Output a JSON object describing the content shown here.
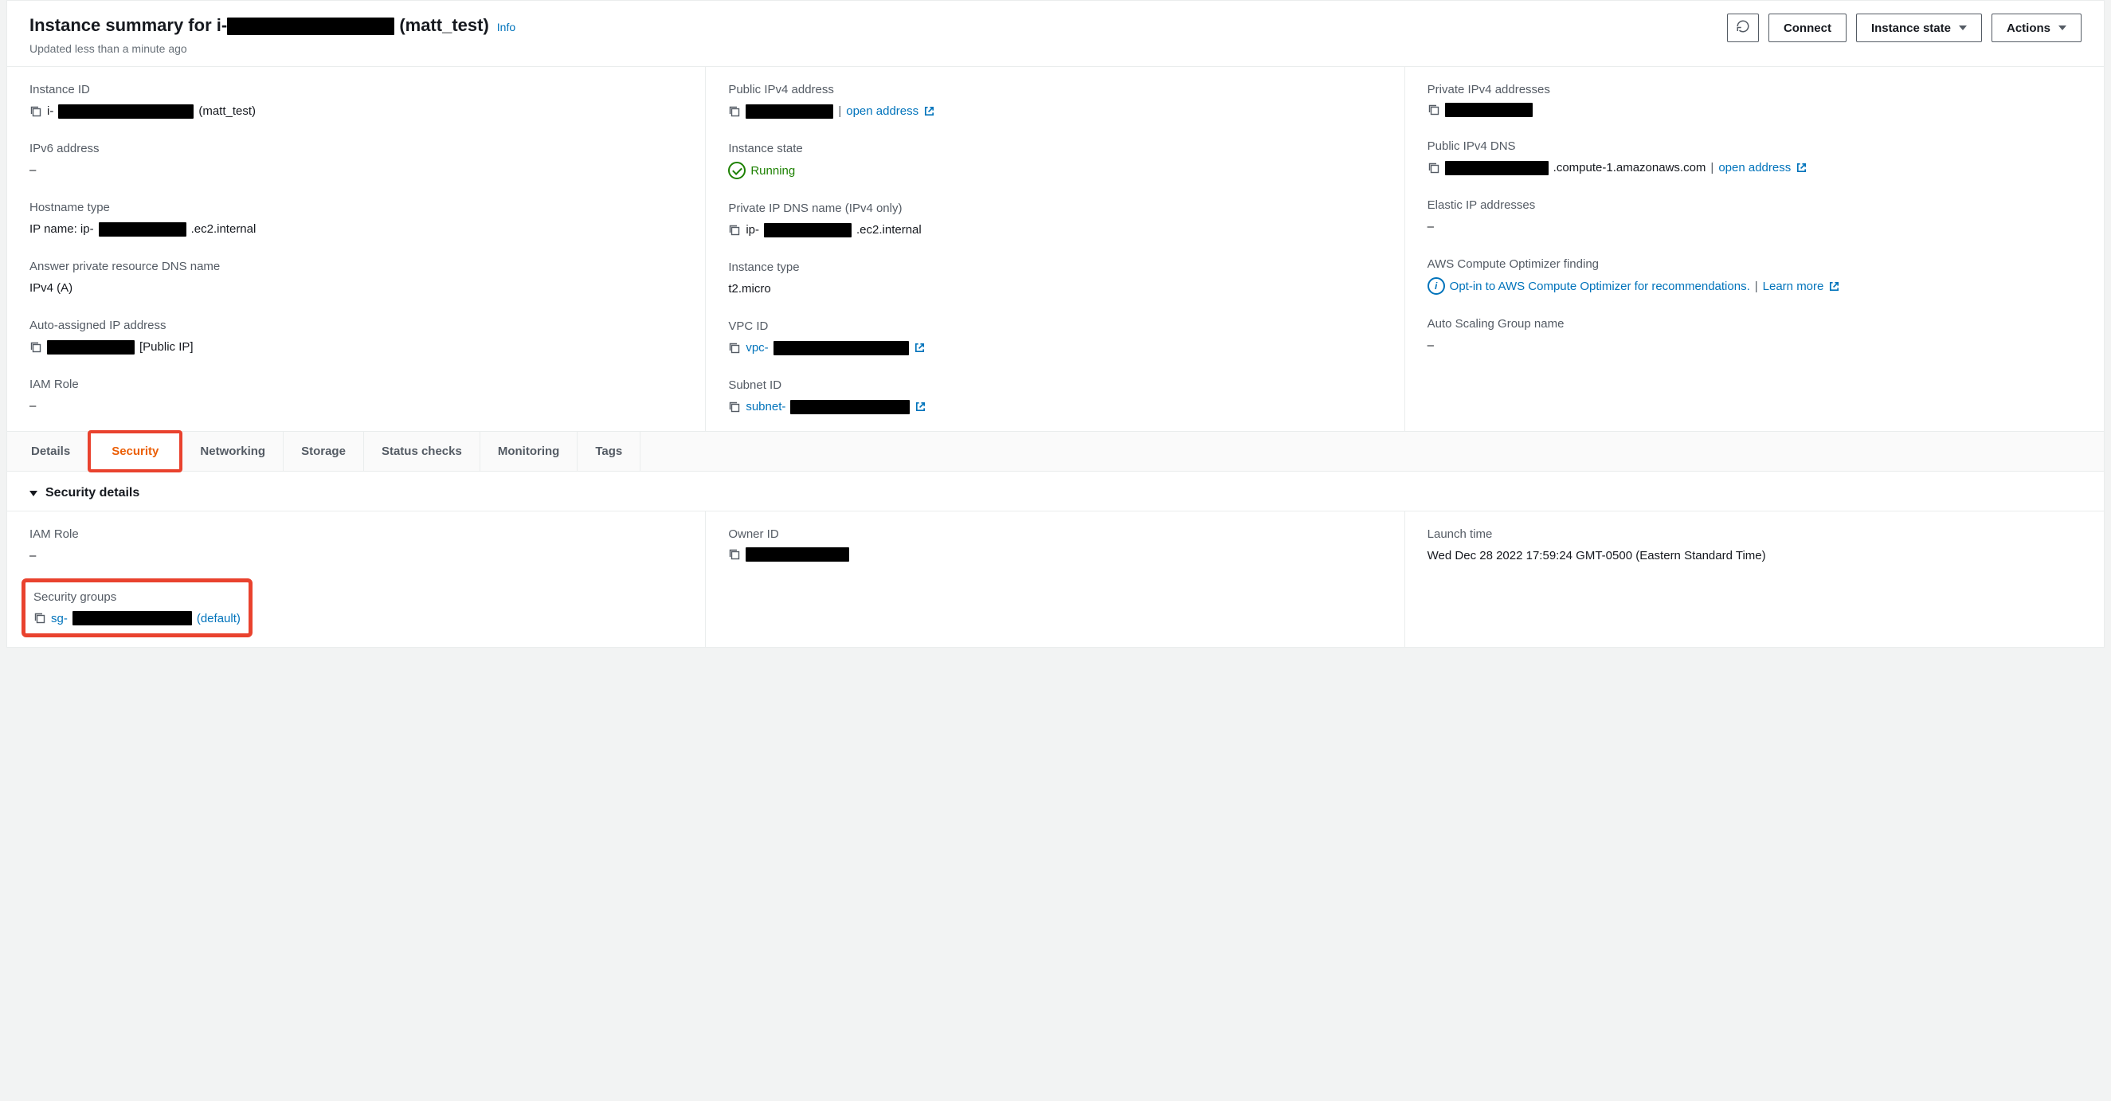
{
  "header": {
    "title_prefix": "Instance summary for i-",
    "title_suffix": "(matt_test)",
    "info_link": "Info",
    "subtitle": "Updated less than a minute ago",
    "connect_btn": "Connect",
    "instance_state_btn": "Instance state",
    "actions_btn": "Actions"
  },
  "summary": {
    "col1": {
      "instance_id": {
        "label": "Instance ID",
        "prefix": "i-",
        "suffix": "(matt_test)"
      },
      "ipv6": {
        "label": "IPv6 address",
        "value": "–"
      },
      "hostname_type": {
        "label": "Hostname type",
        "prefix": "IP name: ip-",
        "suffix": ".ec2.internal"
      },
      "answer_dns": {
        "label": "Answer private resource DNS name",
        "value": "IPv4 (A)"
      },
      "auto_ip": {
        "label": "Auto-assigned IP address",
        "suffix": "[Public IP]"
      },
      "iam_role": {
        "label": "IAM Role",
        "value": "–"
      }
    },
    "col2": {
      "public_ipv4": {
        "label": "Public IPv4 address",
        "open": "open address"
      },
      "state": {
        "label": "Instance state",
        "value": "Running"
      },
      "private_dns": {
        "label": "Private IP DNS name (IPv4 only)",
        "prefix": "ip-",
        "suffix": ".ec2.internal"
      },
      "instance_type": {
        "label": "Instance type",
        "value": "t2.micro"
      },
      "vpc": {
        "label": "VPC ID",
        "prefix": "vpc-"
      },
      "subnet": {
        "label": "Subnet ID",
        "prefix": "subnet-"
      }
    },
    "col3": {
      "private_ipv4": {
        "label": "Private IPv4 addresses"
      },
      "public_dns": {
        "label": "Public IPv4 DNS",
        "suffix": ".compute-1.amazonaws.com",
        "open": "open address"
      },
      "elastic_ip": {
        "label": "Elastic IP addresses",
        "value": "–"
      },
      "optimizer": {
        "label": "AWS Compute Optimizer finding",
        "link1": "Opt-in to AWS Compute Optimizer for recommendations.",
        "learn": "Learn more"
      },
      "asg": {
        "label": "Auto Scaling Group name",
        "value": "–"
      }
    }
  },
  "tabs": [
    "Details",
    "Security",
    "Networking",
    "Storage",
    "Status checks",
    "Monitoring",
    "Tags"
  ],
  "active_tab": "Security",
  "security": {
    "heading": "Security details",
    "iam_role": {
      "label": "IAM Role",
      "value": "–"
    },
    "owner": {
      "label": "Owner ID"
    },
    "launch": {
      "label": "Launch time",
      "value": "Wed Dec 28 2022 17:59:24 GMT-0500 (Eastern Standard Time)"
    },
    "sg": {
      "label": "Security groups",
      "prefix": "sg-",
      "suffix": "(default)"
    }
  }
}
